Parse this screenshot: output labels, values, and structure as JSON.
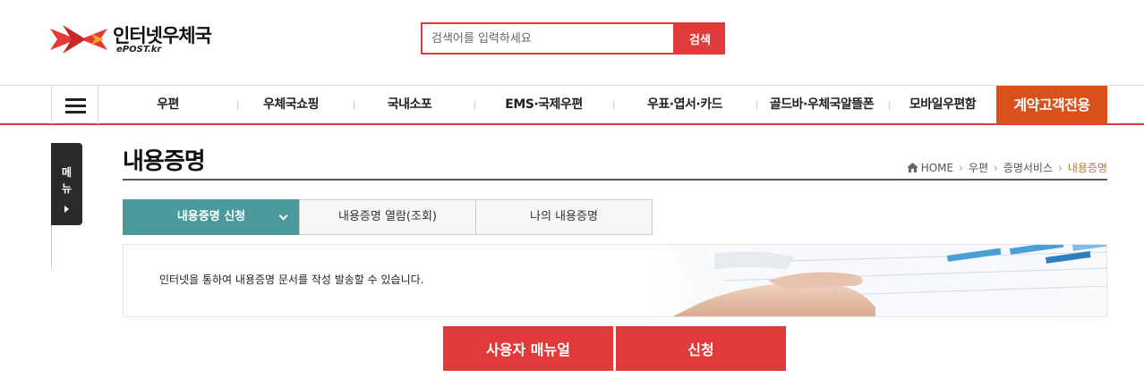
{
  "header": {
    "logo_title": "인터넷우체국",
    "logo_sub": "ePOST.kr",
    "search_placeholder": "검색어를 입력하세요",
    "search_button": "검색"
  },
  "nav": {
    "items": [
      "우편",
      "우체국쇼핑",
      "국내소포",
      "EMS·국제우편",
      "우표·엽서·카드",
      "골드바·우체국알뜰폰",
      "모바일우편함"
    ],
    "special": "계약고객전용"
  },
  "side_menu": {
    "chars": [
      "메",
      "뉴"
    ]
  },
  "page": {
    "title": "내용증명",
    "breadcrumb": [
      "HOME",
      "우편",
      "증명서비스",
      "내용증명"
    ]
  },
  "tabs": [
    "내용증명 신청",
    "내용증명 열람(조회)",
    "나의 내용증명"
  ],
  "banner": {
    "text": "인터넷을 통하여 내용증명 문서를 작성 발송할 수 있습니다."
  },
  "buttons": {
    "manual": "사용자 매뉴얼",
    "apply": "신청"
  },
  "colors": {
    "accent_red": "#e03a3a",
    "nav_special": "#d9501b",
    "tab_active": "#4a9a9c"
  }
}
